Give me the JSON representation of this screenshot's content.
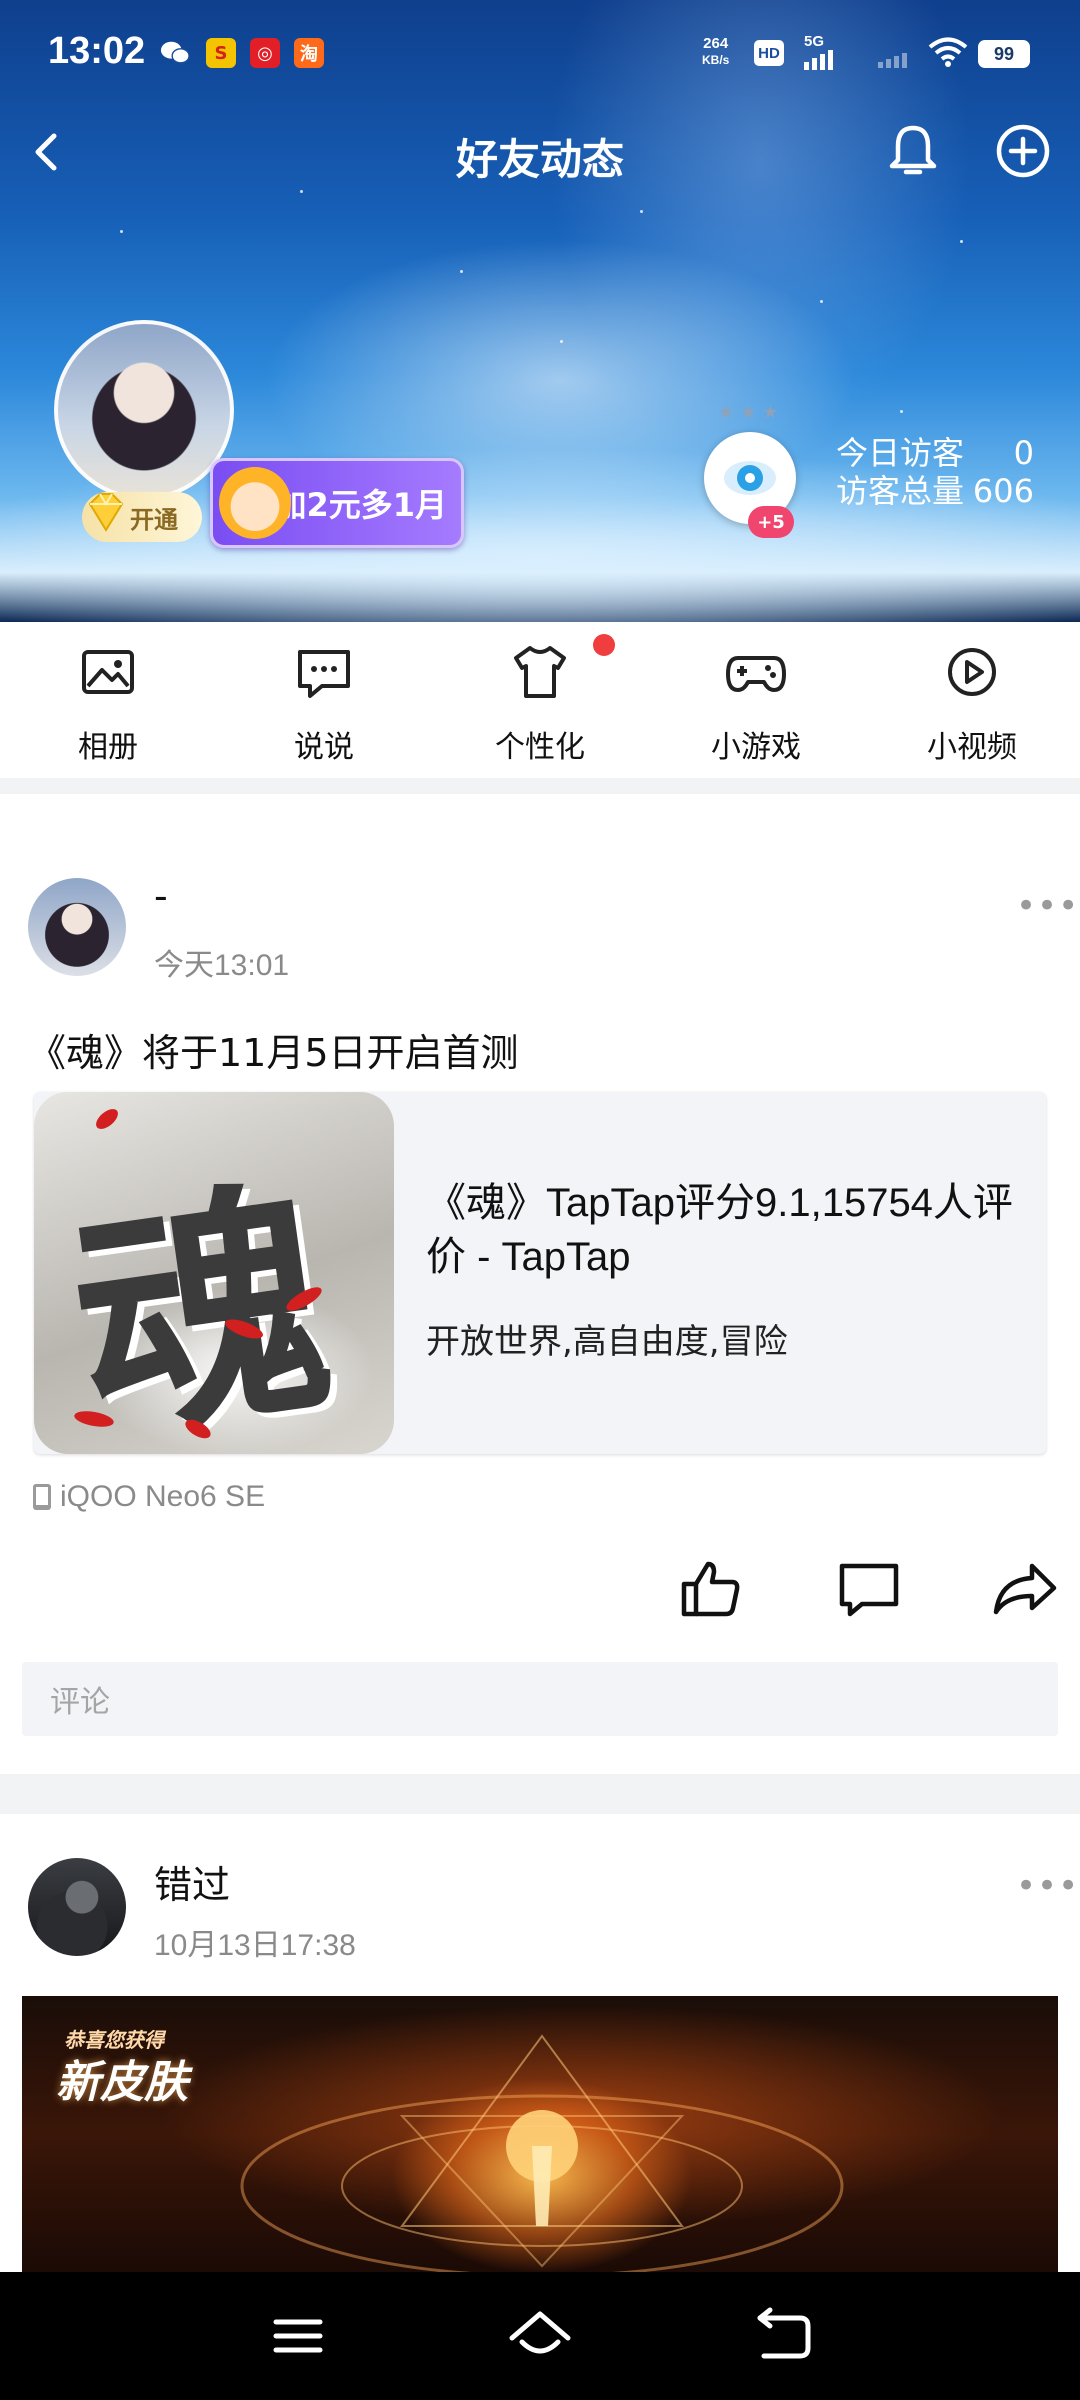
{
  "status_bar": {
    "time": "13:02",
    "net_speed_top": "264",
    "net_speed_bottom": "KB/s",
    "hd_label": "HD",
    "signal_label": "5G",
    "battery": "99"
  },
  "header": {
    "title": "好友动态"
  },
  "profile": {
    "vip_label": "开通",
    "promo_text": "加2元多1月",
    "visitor_badge": "+5",
    "visitors_today_label": "今日访客",
    "visitors_today_value": "0",
    "visitors_total_label": "访客总量",
    "visitors_total_value": "606"
  },
  "menu": {
    "items": [
      {
        "label": "相册",
        "icon": "photo-icon"
      },
      {
        "label": "说说",
        "icon": "chat-icon"
      },
      {
        "label": "个性化",
        "icon": "shirt-icon"
      },
      {
        "label": "小游戏",
        "icon": "gamepad-icon"
      },
      {
        "label": "小视频",
        "icon": "video-icon"
      }
    ]
  },
  "feed": {
    "posts": [
      {
        "author": "-",
        "time": "今天13:01",
        "text": "《魂》将于11月5日开启首测",
        "card": {
          "icon_char": "魂",
          "title": "《魂》TapTap评分9.1,15754人评价 - TapTap",
          "desc": "开放世界,高自由度,冒险"
        },
        "device": "iQOO Neo6 SE",
        "comment_placeholder": "评论"
      },
      {
        "author": "错过",
        "time": "10月13日17:38",
        "banner_small": "恭喜您获得",
        "banner_title": "新皮肤"
      }
    ]
  },
  "more_glyph": "•••",
  "colors": {
    "accent_red": "#f03d3d",
    "promo_purple": "#7a4df2",
    "text_gray": "#8a8a8a"
  }
}
